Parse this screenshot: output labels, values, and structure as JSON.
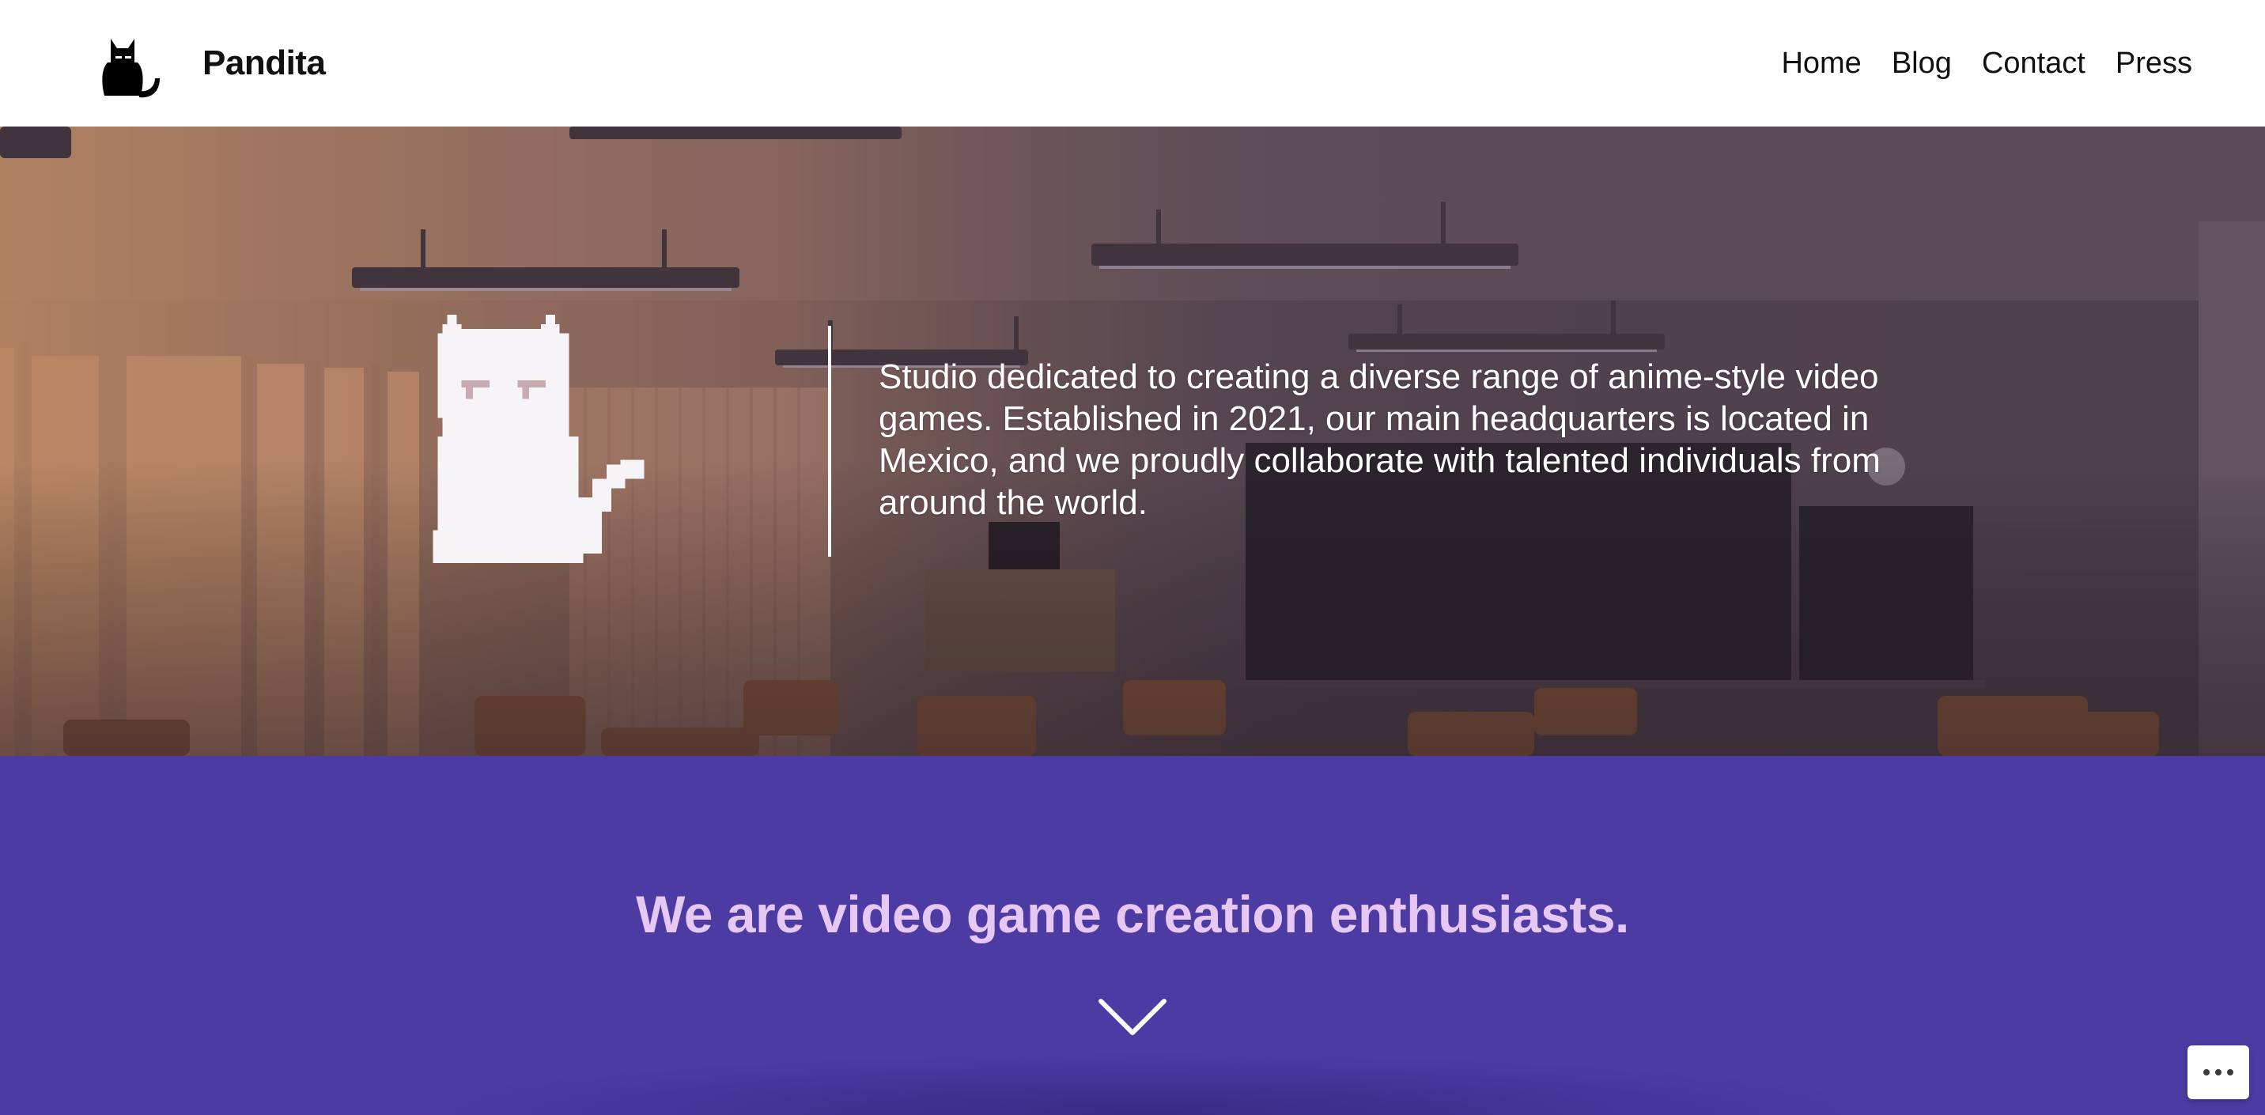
{
  "header": {
    "site_title": "Pandita",
    "nav": [
      {
        "label": "Home"
      },
      {
        "label": "Blog"
      },
      {
        "label": "Contact"
      },
      {
        "label": "Press"
      }
    ]
  },
  "hero": {
    "description": "Studio dedicated to creating a diverse range of anime-style video games. Established in 2021, our main headquarters is located in Mexico, and we proudly collaborate with talented individuals from around the world."
  },
  "band": {
    "tagline": "We are video game creation enthusiasts."
  },
  "colors": {
    "accent_band": "#4c3ba2",
    "tagline_text": "#e7c7f3",
    "header_bg": "#ffffff",
    "hero_text": "#ffffff"
  },
  "icons": {
    "logo": "black-cat-logo",
    "hero_illustration": "pixel-white-cat",
    "scroll_indicator": "chevron-down-icon",
    "more_options": "more-options-icon"
  }
}
